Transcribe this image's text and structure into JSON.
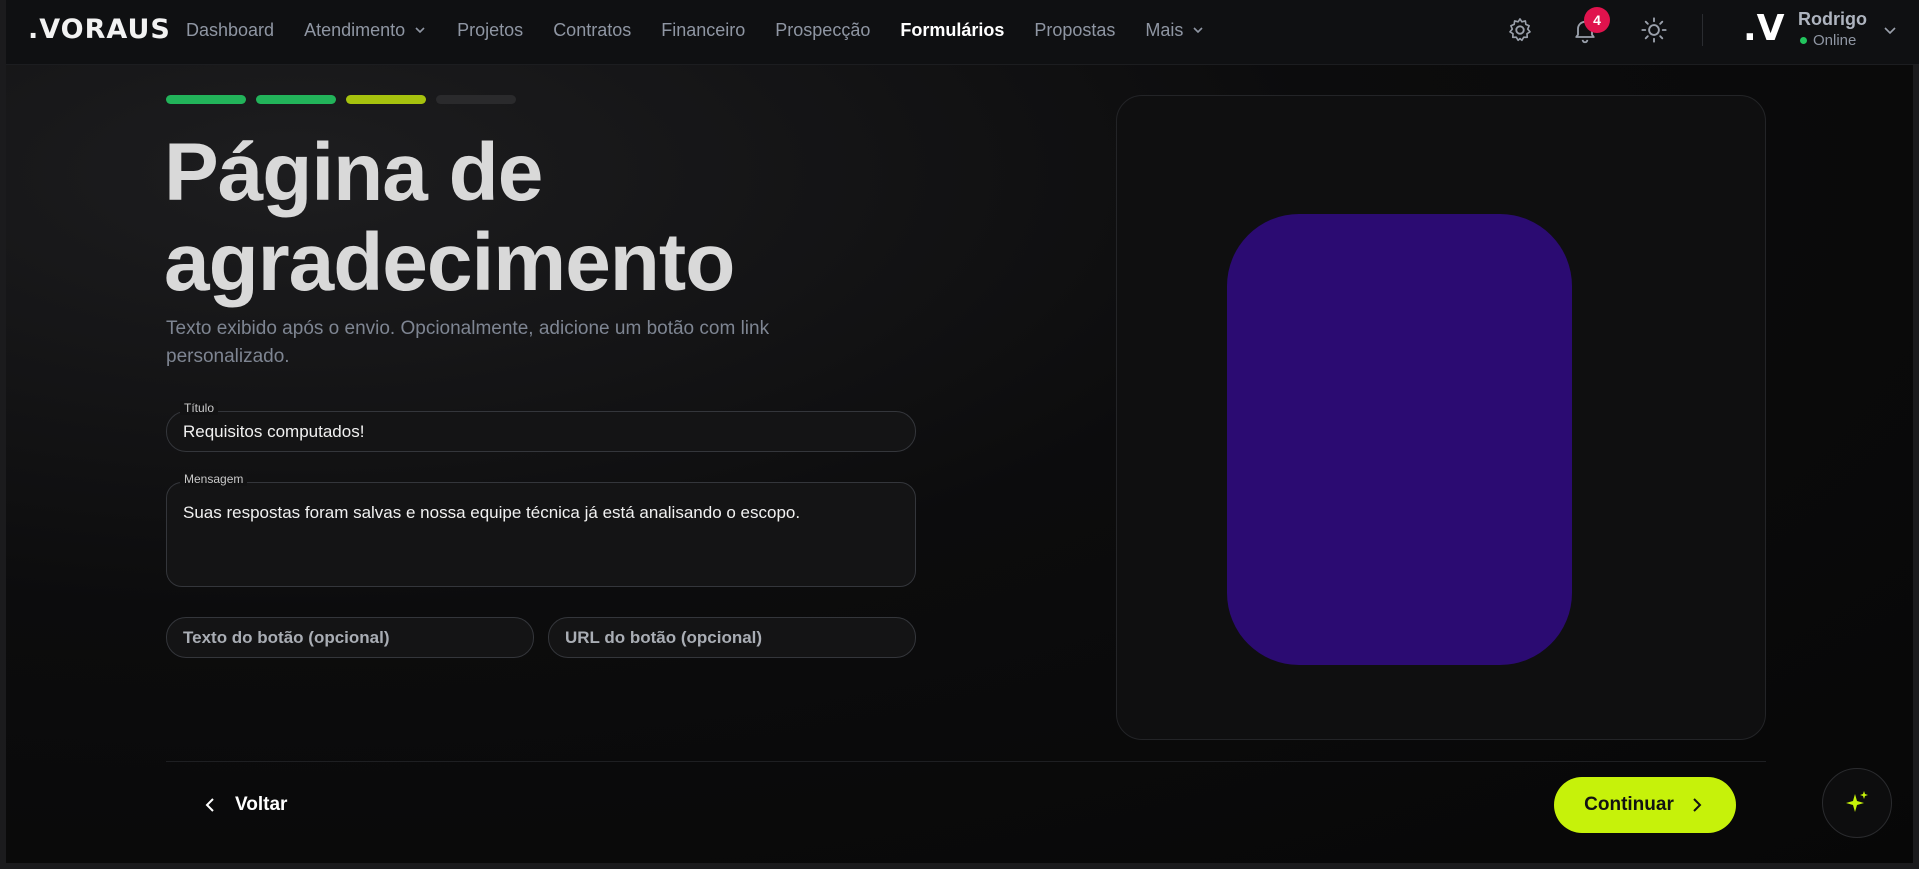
{
  "app": {
    "logo": ".VORAUS"
  },
  "nav": {
    "items": [
      {
        "label": "Dashboard"
      },
      {
        "label": "Atendimento"
      },
      {
        "label": "Projetos"
      },
      {
        "label": "Contratos"
      },
      {
        "label": "Financeiro"
      },
      {
        "label": "Prospecção"
      },
      {
        "label": "Formulários"
      },
      {
        "label": "Propostas"
      },
      {
        "label": "Mais"
      }
    ],
    "notifications_count": "4"
  },
  "user": {
    "logo": ".V",
    "name": "Rodrigo",
    "status": "Online"
  },
  "steps": {
    "total": 4,
    "completed": 3
  },
  "colors": {
    "accent": "#c6f20a",
    "step_done": "#22b35a",
    "step_current": "#a6c20e",
    "step_todo": "#2a2a2c",
    "preview_phone": "#2b0b72",
    "badge": "#e0134d"
  },
  "page": {
    "title": "Página de agradecimento",
    "subtitle": "Texto exibido após o envio. Opcionalmente, adicione um botão com link personalizado."
  },
  "form": {
    "title_label": "Título",
    "title_value": "Requisitos computados!",
    "message_label": "Mensagem",
    "message_value": "Suas respostas foram salvas e nossa equipe técnica já está analisando o escopo.",
    "button_text_placeholder": "Texto do botão (opcional)",
    "button_url_placeholder": "URL do botão (opcional)"
  },
  "footer": {
    "back_label": "Voltar",
    "continue_label": "Continuar"
  }
}
